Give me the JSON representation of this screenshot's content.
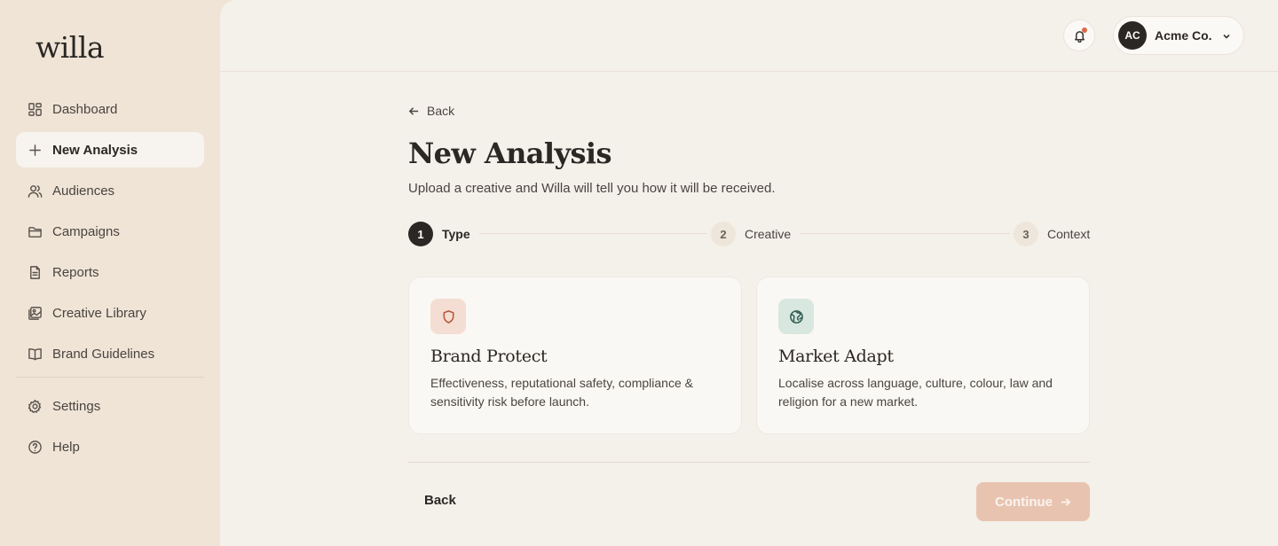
{
  "app": {
    "logo": "willa"
  },
  "sidebar": {
    "items": [
      {
        "label": "Dashboard",
        "icon": "dashboard-icon"
      },
      {
        "label": "New Analysis",
        "icon": "plus-icon",
        "active": true
      },
      {
        "label": "Audiences",
        "icon": "users-icon"
      },
      {
        "label": "Campaigns",
        "icon": "folder-icon"
      },
      {
        "label": "Reports",
        "icon": "document-icon"
      },
      {
        "label": "Creative Library",
        "icon": "image-icon"
      },
      {
        "label": "Brand Guidelines",
        "icon": "book-icon"
      }
    ],
    "secondary": [
      {
        "label": "Settings",
        "icon": "gear-icon"
      },
      {
        "label": "Help",
        "icon": "help-icon"
      }
    ]
  },
  "header": {
    "account_initials": "AC",
    "account_name": "Acme Co.",
    "notification_dot": true
  },
  "page": {
    "back_label": "Back",
    "title": "New Analysis",
    "subtitle": "Upload a creative and Willa will tell you how it will be received."
  },
  "stepper": {
    "current": 1,
    "steps": [
      {
        "num": "1",
        "label": "Type"
      },
      {
        "num": "2",
        "label": "Creative"
      },
      {
        "num": "3",
        "label": "Context"
      }
    ]
  },
  "cards": [
    {
      "title": "Brand Protect",
      "description": "Effectiveness, reputational safety, compliance & sensitivity risk before launch.",
      "icon": "shield-icon",
      "icon_bg": "#f4ddd2",
      "icon_color": "#b5553a"
    },
    {
      "title": "Market Adapt",
      "description": "Localise across language, culture, colour, law and religion for a new market.",
      "icon": "globe-icon",
      "icon_bg": "#d9e7e1",
      "icon_color": "#2f5e52"
    }
  ],
  "footer": {
    "back_label": "Back",
    "continue_label": "Continue",
    "continue_disabled": true
  },
  "colors": {
    "sidebar_bg": "#efe4d6",
    "main_bg": "#f4f0ea",
    "accent_disabled": "#e8c4b0",
    "dark": "#2b2724"
  }
}
